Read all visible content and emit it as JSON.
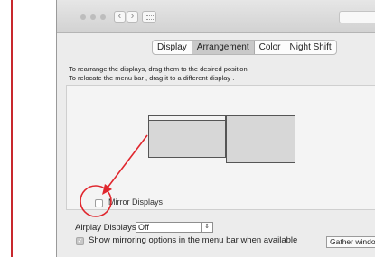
{
  "tabs": [
    {
      "label": "Display",
      "selected": false
    },
    {
      "label": "Arrangement",
      "selected": true
    },
    {
      "label": "Color",
      "selected": false
    },
    {
      "label": "Night Shift",
      "selected": false
    }
  ],
  "instructions": {
    "line1": "To rearrange the displays, drag them to the desired position.",
    "line2": "To relocate the menu bar , drag it to a different display  ."
  },
  "mirror_displays": {
    "label": "Mirror Displays",
    "checked": false
  },
  "airplay": {
    "label": "Airplay Displays :",
    "value": "Off"
  },
  "show_mirroring": {
    "label": "Show mirroring options in the menu bar when available",
    "checked": true
  },
  "gather_button": {
    "label": "Gather windows"
  },
  "colors": {
    "annotation": "#e0262d",
    "divider": "#c8282d"
  }
}
